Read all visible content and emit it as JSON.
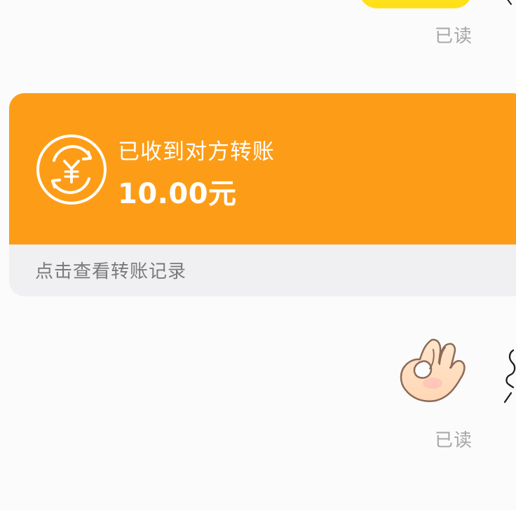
{
  "messages": {
    "top_read_status": "已读",
    "bottom_read_status": "已读",
    "ok_emoji": "ok-hand-emoji"
  },
  "transfer": {
    "status_title": "已收到对方转账",
    "amount": "10.00元",
    "footer_link": "点击查看转账记录",
    "icon": "yuan-coin-exchange-icon"
  },
  "colors": {
    "transfer_orange": "#fd9d17",
    "transfer_footer_bg": "#f0eff2",
    "message_yellow": "#ffe01a",
    "read_gray": "#a6a6a6",
    "background": "#fbfbfb"
  }
}
